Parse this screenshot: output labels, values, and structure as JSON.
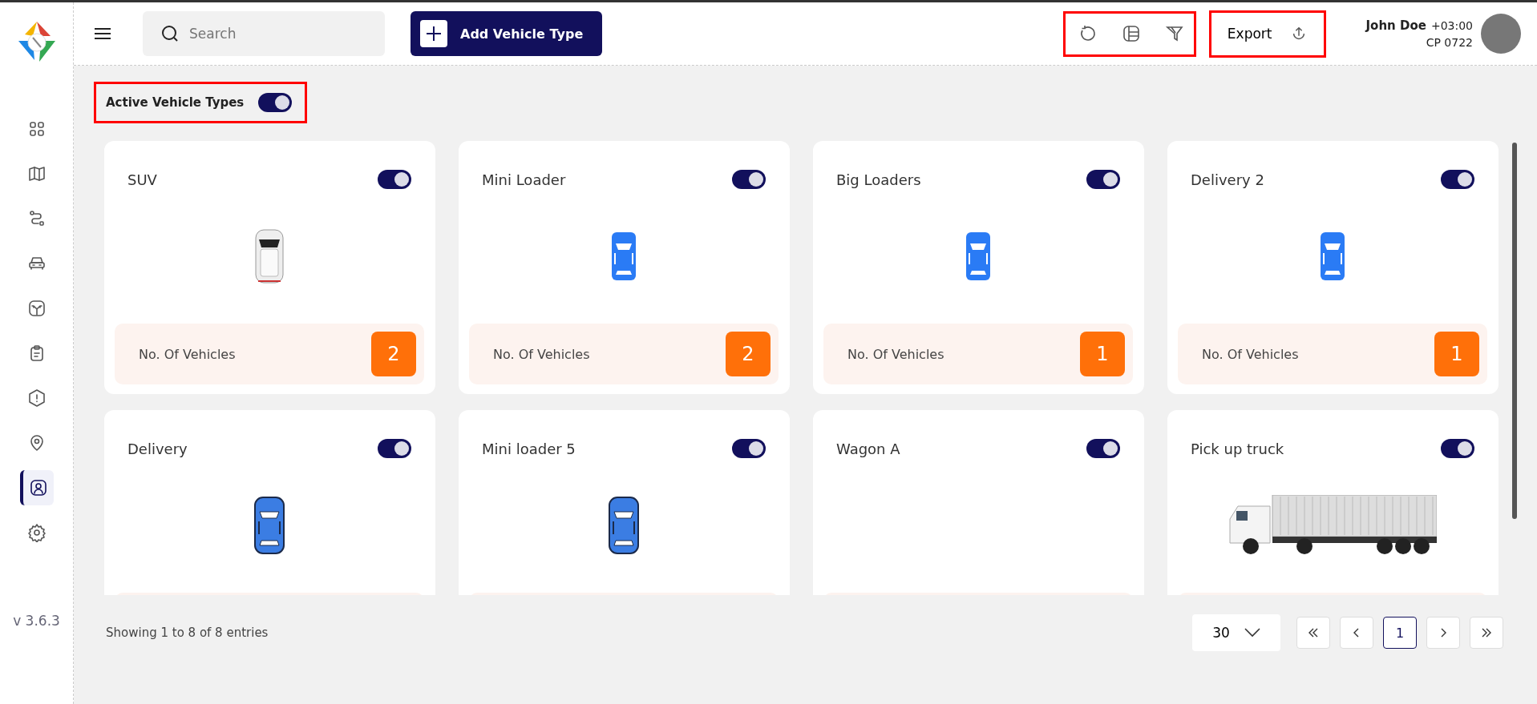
{
  "sidebar": {
    "version": "v 3.6.3",
    "items": [
      {
        "kind": "grid",
        "selected": false
      },
      {
        "kind": "map",
        "selected": false
      },
      {
        "kind": "route",
        "selected": false
      },
      {
        "kind": "car",
        "selected": false
      },
      {
        "kind": "fork",
        "selected": false
      },
      {
        "kind": "clipboard",
        "selected": false
      },
      {
        "kind": "alert",
        "selected": false
      },
      {
        "kind": "pin",
        "selected": false
      },
      {
        "kind": "user",
        "selected": true
      },
      {
        "kind": "gear",
        "selected": false
      }
    ]
  },
  "header": {
    "search": {
      "placeholder": "Search"
    },
    "add_button": "Add Vehicle Type",
    "export_button": "Export",
    "user": {
      "name": "John Doe",
      "timezone": "+03:00",
      "code": "CP 0722"
    }
  },
  "filter": {
    "label": "Active Vehicle Types",
    "on": true
  },
  "cards": [
    {
      "title": "SUV",
      "on": true,
      "kind": "photo",
      "count_label": "No. Of Vehicles",
      "count": "2"
    },
    {
      "title": "Mini Loader",
      "on": true,
      "kind": "flat",
      "count_label": "No. Of Vehicles",
      "count": "2"
    },
    {
      "title": "Big Loaders",
      "on": true,
      "kind": "flat",
      "count_label": "No. Of Vehicles",
      "count": "1"
    },
    {
      "title": "Delivery 2",
      "on": true,
      "kind": "flat",
      "count_label": "No. Of Vehicles",
      "count": "1"
    },
    {
      "title": "Delivery",
      "on": true,
      "kind": "outlined"
    },
    {
      "title": "Mini loader 5",
      "on": true,
      "kind": "outlined"
    },
    {
      "title": "Wagon A",
      "on": true,
      "kind": "empty"
    },
    {
      "title": "Pick up truck",
      "on": true,
      "kind": "truck"
    }
  ],
  "footer": {
    "entries": "Showing 1 to 8 of 8 entries",
    "page_size": "30",
    "pages": [
      {
        "label": "1",
        "selected": true
      }
    ]
  }
}
